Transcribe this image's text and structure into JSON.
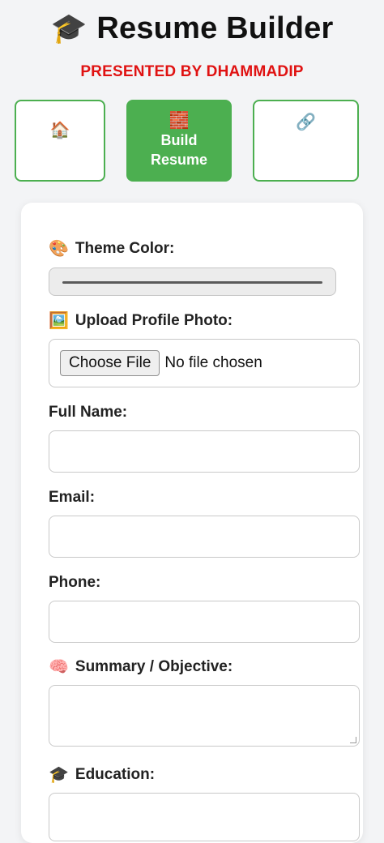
{
  "header": {
    "icon": "graduation-cap-icon",
    "cap_glyph": "🎓",
    "title": "Resume Builder",
    "subtitle": "PRESENTED BY DHAMMADIP",
    "subtitle_color": "#e01212"
  },
  "nav": {
    "home": {
      "icon": "home-icon",
      "glyph": "🏠"
    },
    "build": {
      "icon": "brick-icon",
      "glyph": "🧱",
      "label": "Build Resume"
    },
    "share": {
      "icon": "link-icon",
      "glyph": "🔗"
    },
    "accent": "#4caf50"
  },
  "form": {
    "theme_color": {
      "icon": "palette-icon",
      "glyph": "🎨",
      "label": "Theme Color:",
      "value": "#555555"
    },
    "photo": {
      "icon": "picture-icon",
      "glyph": "🖼️",
      "label": "Upload Profile Photo:",
      "button": "Choose File",
      "status": "No file chosen"
    },
    "full_name": {
      "label": "Full Name:",
      "value": ""
    },
    "email": {
      "label": "Email:",
      "value": ""
    },
    "phone": {
      "label": "Phone:",
      "value": ""
    },
    "summary": {
      "icon": "brain-icon",
      "glyph": "🧠",
      "label": "Summary / Objective:",
      "value": ""
    },
    "education": {
      "icon": "graduation-cap-icon",
      "glyph": "🎓",
      "label": "Education:",
      "value": ""
    }
  }
}
